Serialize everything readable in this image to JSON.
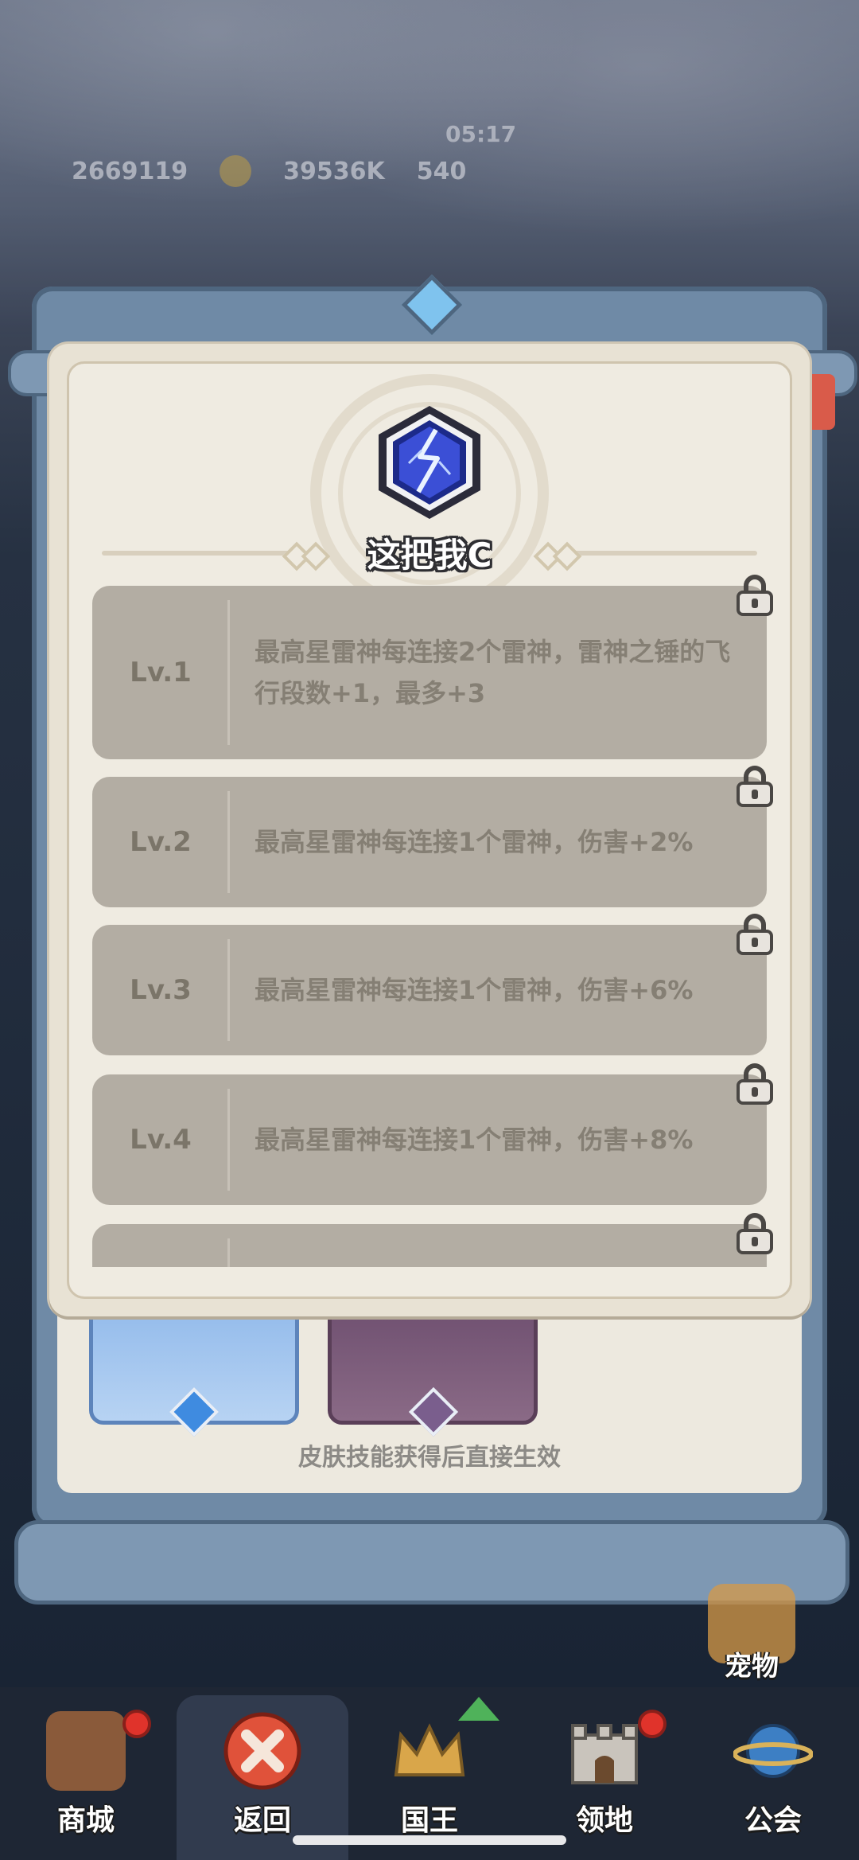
{
  "hud": {
    "power": "2669119",
    "gold": "39536K",
    "timer": "05:17",
    "gems": "540"
  },
  "modal": {
    "title": "这把我C",
    "levels": [
      {
        "label": "Lv.1",
        "desc": "最高星雷神每连接2个雷神，雷神之锤的飞行段数+1，最多+3",
        "locked": true
      },
      {
        "label": "Lv.2",
        "desc": "最高星雷神每连接1个雷神，伤害+2%",
        "locked": true
      },
      {
        "label": "Lv.3",
        "desc": "最高星雷神每连接1个雷神，伤害+6%",
        "locked": true
      },
      {
        "label": "Lv.4",
        "desc": "最高星雷神每连接1个雷神，伤害+8%",
        "locked": true
      },
      {
        "label": "",
        "desc": "",
        "locked": true
      }
    ]
  },
  "skin_panel": {
    "note": "皮肤技能获得后直接生效"
  },
  "pet": {
    "label": "宠物"
  },
  "nav": {
    "items": [
      {
        "label": "商城",
        "icon": "shop-icon",
        "badge": true
      },
      {
        "label": "返回",
        "icon": "close-icon",
        "active": true
      },
      {
        "label": "国王",
        "icon": "crown-icon",
        "upgrade": true
      },
      {
        "label": "领地",
        "icon": "castle-icon",
        "badge": true
      },
      {
        "label": "公会",
        "icon": "planet-icon"
      }
    ]
  },
  "colors": {
    "modal_bg": "#e8e2d4",
    "row_bg": "#b3ada3",
    "row_text": "#857f74",
    "frame": "#6f8aa6",
    "badge_red": "#e0332b",
    "upgrade_green": "#4fb25a"
  }
}
